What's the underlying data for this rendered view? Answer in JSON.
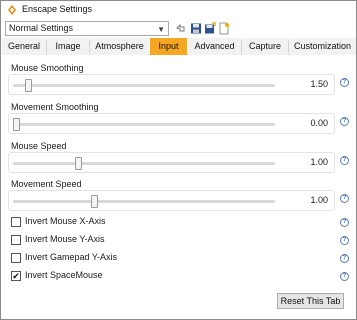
{
  "window": {
    "title": "Enscape Settings"
  },
  "preset": {
    "value": "Normal Settings"
  },
  "tabs": [
    {
      "label": "General"
    },
    {
      "label": "Image"
    },
    {
      "label": "Atmosphere"
    },
    {
      "label": "Input",
      "active": true
    },
    {
      "label": "Advanced"
    },
    {
      "label": "Capture"
    },
    {
      "label": "Customization"
    }
  ],
  "sliders": [
    {
      "label": "Mouse Smoothing",
      "value": "1.50",
      "fraction": 0.06
    },
    {
      "label": "Movement Smoothing",
      "value": "0.00",
      "fraction": 0.0
    },
    {
      "label": "Mouse Speed",
      "value": "1.00",
      "fraction": 0.25
    },
    {
      "label": "Movement Speed",
      "value": "1.00",
      "fraction": 0.31
    }
  ],
  "checkboxes": [
    {
      "label": "Invert Mouse X-Axis",
      "checked": false
    },
    {
      "label": "Invert Mouse Y-Axis",
      "checked": false
    },
    {
      "label": "Invert Gamepad Y-Axis",
      "checked": false
    },
    {
      "label": "Invert SpaceMouse",
      "checked": true
    }
  ],
  "help_glyph": "?",
  "check_glyph": "✔",
  "reset_label": "Reset This Tab",
  "colors": {
    "active_tab": "#f5a623",
    "help": "#3a64a0"
  }
}
